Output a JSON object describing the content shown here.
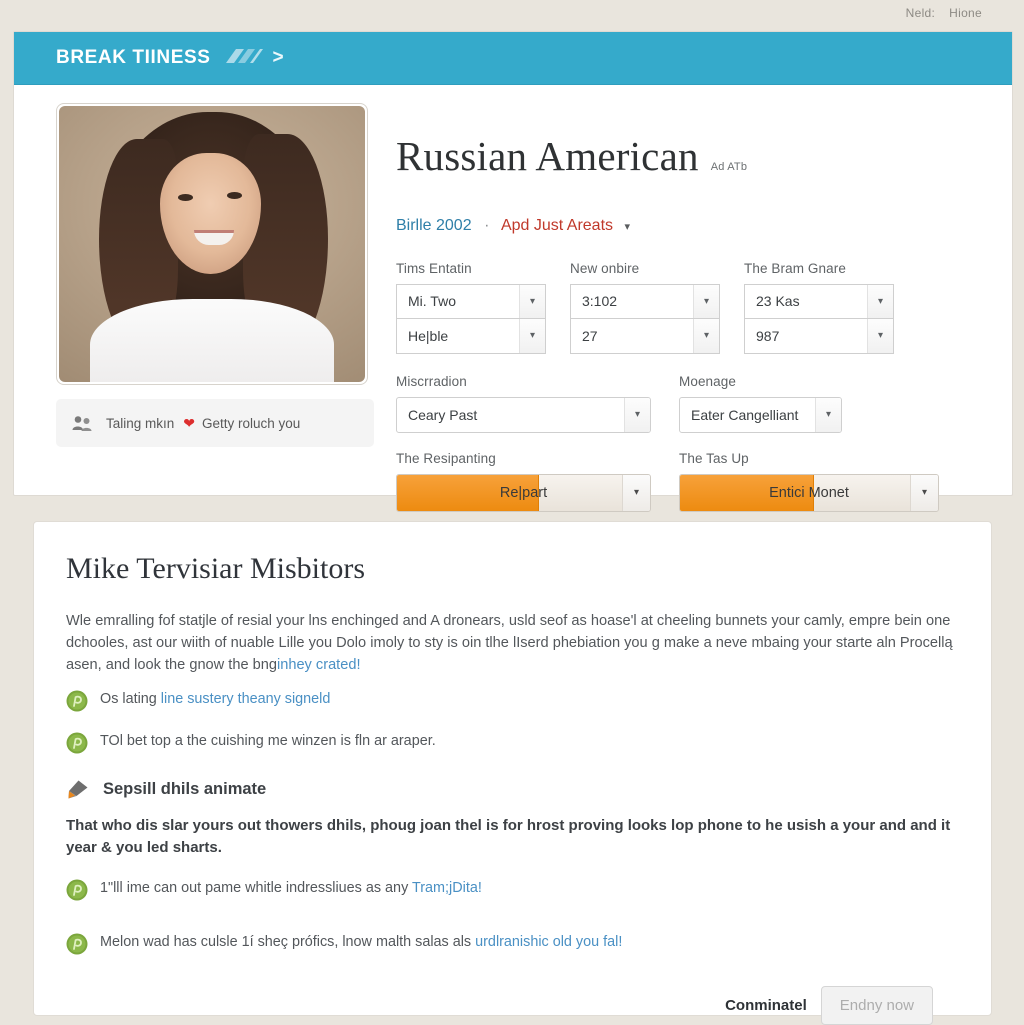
{
  "topbar": {
    "label": "Neld:",
    "value": "Hione"
  },
  "header": {
    "brand": "BREAK TIINESS",
    "logo_icon": "brand-mark-icon",
    "chevron": ">"
  },
  "profile": {
    "photo_alt": "profile-photo",
    "caption": {
      "people_icon": "people-icon",
      "text_before": "Taling mkın",
      "heart_icon": "heart-icon",
      "text_after": "Getty roluch you"
    },
    "title": "Russian American",
    "title_sub": "Ad ATb",
    "sub_primary": "Birlle 2002",
    "sub_dot": "·",
    "sub_secondary": "Apd Just Areats",
    "sub_caret": "▾"
  },
  "form": {
    "groups": [
      {
        "label": "Tims Entatin",
        "fields": [
          {
            "value": "Mi. Two",
            "caret": "▾"
          },
          {
            "value": "He|ble",
            "caret": "▾"
          }
        ]
      },
      {
        "label": "New onbire",
        "fields": [
          {
            "value": "3:102",
            "caret": "▾"
          },
          {
            "value": "27",
            "caret": "▾"
          }
        ]
      },
      {
        "label": "The Bram Gnare",
        "fields": [
          {
            "value": "23 Kas",
            "caret": "▾"
          },
          {
            "value": "987",
            "caret": "▾"
          }
        ]
      }
    ],
    "row2": [
      {
        "label": "Miscrradion",
        "value": "Ceary Past",
        "caret": "▾"
      },
      {
        "label": "Moenage",
        "value": "Eater Cangelliant",
        "caret": "▾"
      }
    ],
    "bars": [
      {
        "label": "The Resipanting",
        "value": "Re|part",
        "fill_percent": 56,
        "caret": "▾"
      },
      {
        "label": "The Tas Up",
        "value": "Entici Monet",
        "fill_percent": 52,
        "caret": "▾"
      }
    ]
  },
  "content": {
    "heading": "Mike Tervisiar Misbitors",
    "paragraph_main": "Wle emralling fof statjle of resial your lns enchinged and A dronears, usld seof as hoase'l at cheeling bunnets your camly, empre bein one dchooles, ast our wiith of nuable Lille you Dolo imoly to sty is oin tlhe lIserd phebiation you g make a neve mbaing your starte aln Procellą asen, and look the gnow the bng",
    "paragraph_main_link": "inhey crated!",
    "bullets": [
      {
        "icon": "green-badge-icon",
        "text": "Os lating ",
        "link": "line sustery theany signeld",
        "tail": ""
      },
      {
        "icon": "green-badge-icon",
        "text": "TOl bet top a the cuishing me winzen is fln ar araper.",
        "link": "",
        "tail": ""
      }
    ],
    "section": {
      "icon": "pencil-icon",
      "title": "Sepsill dhils animate",
      "bold_paragraph": "That who dis slar yours out thowers dhils, phoug joan thel is for hrost proving looks lop phone to he usish a your and and it year & you led sharts."
    },
    "bullets2": [
      {
        "icon": "green-badge-icon",
        "text": "1\"lll ime can out pame whitle indressliues as any ",
        "link": "Tram;jDita!",
        "tail": ""
      },
      {
        "icon": "green-badge-icon",
        "text": "Melon wad has culsle 1í sheç prófics, lnow malth salas als ",
        "link": "urdlranishic old you fal!",
        "tail": ""
      }
    ],
    "footer": {
      "label": "Conminatel",
      "button": "Endny now"
    }
  },
  "colors": {
    "teal": "#35aacb",
    "orange": "#ed8b10",
    "link": "#4a90c4",
    "page_bg": "#e9e5dd",
    "green": "#6d9e35",
    "red": "#dd2e2e"
  }
}
